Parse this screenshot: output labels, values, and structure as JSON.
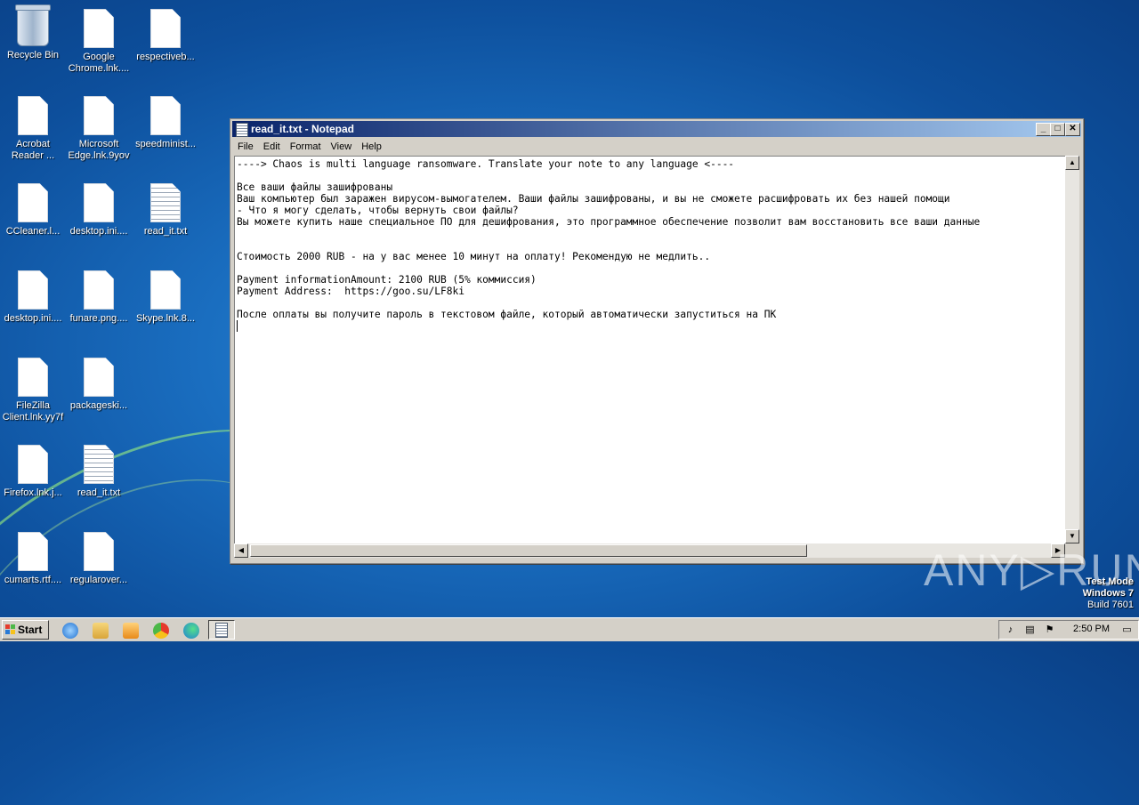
{
  "desktop": {
    "icons": [
      {
        "label": "Recycle Bin"
      },
      {
        "label": "Google Chrome.lnk...."
      },
      {
        "label": "respectiveb..."
      },
      {
        "label": "Acrobat Reader ..."
      },
      {
        "label": "Microsoft Edge.lnk.9yov"
      },
      {
        "label": "speedminist..."
      },
      {
        "label": "CCleaner.l..."
      },
      {
        "label": "desktop.ini...."
      },
      {
        "label": "read_it.txt"
      },
      {
        "label": "desktop.ini...."
      },
      {
        "label": "funare.png...."
      },
      {
        "label": "Skype.lnk.8..."
      },
      {
        "label": "FileZilla Client.lnk.yy7f"
      },
      {
        "label": "packageski..."
      },
      {
        "label": "Firefox.lnk.j..."
      },
      {
        "label": "read_it.txt"
      },
      {
        "label": "cumarts.rtf...."
      },
      {
        "label": "regularover..."
      }
    ]
  },
  "notepad": {
    "title": "read_it.txt - Notepad",
    "menu": [
      "File",
      "Edit",
      "Format",
      "View",
      "Help"
    ],
    "content": "----> Chaos is multi language ransomware. Translate your note to any language <----\n\nВсе ваши файлы зашифрованы\nВаш компьютер был заражен вирусом-вымогателем. Ваши файлы зашифрованы, и вы не сможете расшифровать их без нашей помощи\n- Что я могу сделать, чтобы вернуть свои файлы?\nВы можете купить наше специальное ПО для дешифрования, это программное обеспечение позволит вам восстановить все ваши данные\n\n\nСтоимость 2000 RUB - на у вас менее 10 минут на оплату! Рекомендую не медлить..\n\nPayment informationAmount: 2100 RUB (5% коммиссия)\nPayment Address:  https://goo.su/LF8ki\n\nПосле оплаты вы получите пароль в текстовом файле, который автоматически запуститься на ПК\n"
  },
  "watermark": "ANY▷RUN",
  "system_info": {
    "line1": "Test Mode",
    "line2": "Windows 7",
    "line3": "Build 7601"
  },
  "taskbar": {
    "start_label": "Start",
    "clock": "2:50 PM"
  }
}
